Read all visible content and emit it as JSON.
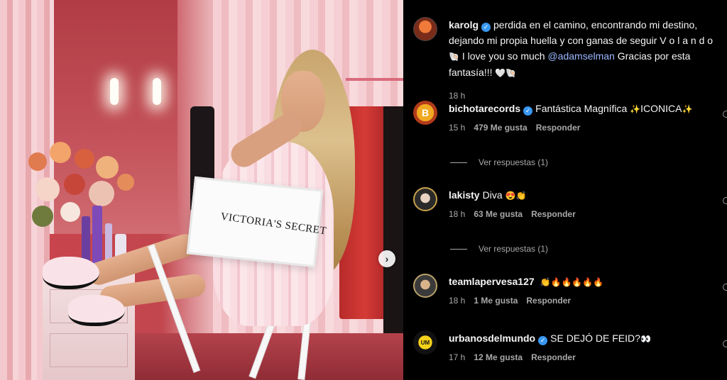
{
  "post": {
    "photo_overlay_text": "VICTORIA'S SECRET",
    "next_icon": "chevron-right-icon"
  },
  "caption": {
    "username": "karolg",
    "text": "perdida en el camino, encontrando mi destino, dejando mi propia huella y con ganas de seguir V o l a n d o",
    "text2": "I love you so much",
    "mention": "@adamselman",
    "text3": "Gracias por esta fantasía!!!",
    "time": "18 h"
  },
  "comments": [
    {
      "username": "bichotarecords",
      "verified": true,
      "text": "Fantástica Magnífica",
      "text2": "ICONICA",
      "time": "15 h",
      "likes": "479 Me gusta",
      "reply": "Responder",
      "view_replies": "Ver respuestas (1)"
    },
    {
      "username": "lakisty",
      "verified": false,
      "text": "Diva",
      "time": "18 h",
      "likes": "63 Me gusta",
      "reply": "Responder",
      "view_replies": "Ver respuestas (1)"
    },
    {
      "username": "teamlapervesa127",
      "verified": false,
      "text": "",
      "time": "18 h",
      "likes": "1 Me gusta",
      "reply": "Responder"
    },
    {
      "username": "urbanosdelmundo",
      "verified": true,
      "text": "SE DEJÓ DE FEID?",
      "time": "17 h",
      "likes": "12 Me gusta",
      "reply": "Responder"
    }
  ],
  "colors": {
    "background": "#000000",
    "text": "#f5f5f5",
    "muted": "#a8a8a8",
    "verified": "#3897f0",
    "mention": "#9bb8ff"
  }
}
